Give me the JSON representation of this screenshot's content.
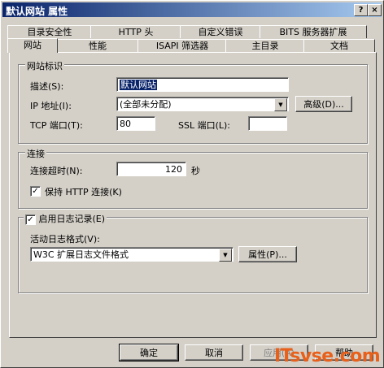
{
  "window": {
    "title": "默认网站 属性",
    "help_glyph": "?",
    "close_glyph": "×"
  },
  "tabs_back": [
    "目录安全性",
    "HTTP 头",
    "自定义错误",
    "BITS 服务器扩展"
  ],
  "tabs_front": [
    "网站",
    "性能",
    "ISAPI 筛选器",
    "主目录",
    "文档"
  ],
  "site_id": {
    "group_title": "网站标识",
    "desc_label": "描述(S):",
    "desc_value": "默认网站",
    "ip_label": "IP 地址(I):",
    "ip_value": "(全部未分配)",
    "advanced_button": "高级(D)...",
    "tcp_label": "TCP 端口(T):",
    "tcp_value": "80",
    "ssl_label": "SSL 端口(L):",
    "ssl_value": ""
  },
  "connection": {
    "group_title": "连接",
    "timeout_label": "连接超时(N):",
    "timeout_value": "120",
    "timeout_unit": "秒",
    "keepalive_label": "保持 HTTP 连接(K)",
    "keepalive_checked": true
  },
  "logging": {
    "enable_label": "启用日志记录(E)",
    "enable_checked": true,
    "format_label": "活动日志格式(V):",
    "format_value": "W3C 扩展日志文件格式",
    "properties_button": "属性(P)..."
  },
  "buttons": {
    "ok": "确定",
    "cancel": "取消",
    "apply": "应用(A)",
    "help": "帮助"
  },
  "watermark": "ITsvse.com",
  "check_glyph": "✓",
  "dropdown_glyph": "▼"
}
